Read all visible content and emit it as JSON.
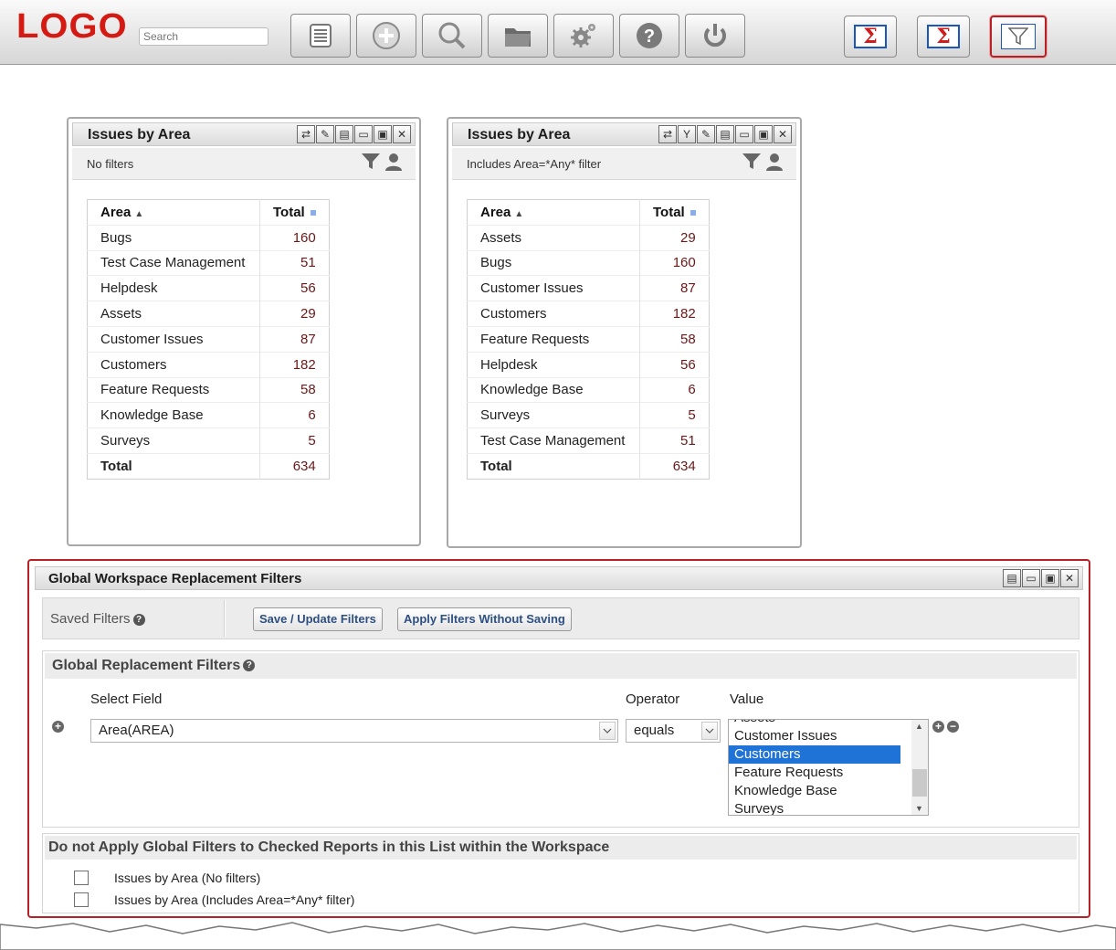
{
  "toolbar": {
    "logo": "LOGO",
    "search_placeholder": "Search",
    "buttons": [
      "list-icon",
      "add-icon",
      "search-icon",
      "folder-icon",
      "settings-icon",
      "help-icon",
      "power-icon"
    ],
    "sigma_glyph": "Σ"
  },
  "report1": {
    "title": "Issues by Area",
    "subtitle": "No filters",
    "header": {
      "area": "Area",
      "total": "Total"
    },
    "rows": [
      {
        "area": "Bugs",
        "total": "160"
      },
      {
        "area": "Test Case Management",
        "total": "51"
      },
      {
        "area": "Helpdesk",
        "total": "56"
      },
      {
        "area": "Assets",
        "total": "29"
      },
      {
        "area": "Customer Issues",
        "total": "87"
      },
      {
        "area": "Customers",
        "total": "182"
      },
      {
        "area": "Feature Requests",
        "total": "58"
      },
      {
        "area": "Knowledge Base",
        "total": "6"
      },
      {
        "area": "Surveys",
        "total": "5"
      }
    ],
    "total": {
      "label": "Total",
      "value": "634"
    }
  },
  "report2": {
    "title": "Issues by Area",
    "subtitle": "Includes Area=*Any* filter",
    "header": {
      "area": "Area",
      "total": "Total"
    },
    "rows": [
      {
        "area": "Assets",
        "total": "29"
      },
      {
        "area": "Bugs",
        "total": "160"
      },
      {
        "area": "Customer Issues",
        "total": "87"
      },
      {
        "area": "Customers",
        "total": "182"
      },
      {
        "area": "Feature Requests",
        "total": "58"
      },
      {
        "area": "Helpdesk",
        "total": "56"
      },
      {
        "area": "Knowledge Base",
        "total": "6"
      },
      {
        "area": "Surveys",
        "total": "5"
      },
      {
        "area": "Test Case Management",
        "total": "51"
      }
    ],
    "total": {
      "label": "Total",
      "value": "634"
    }
  },
  "global": {
    "title": "Global Workspace Replacement Filters",
    "saved_filters_label": "Saved Filters",
    "save_button": "Save / Update Filters",
    "apply_button": "Apply Filters Without Saving",
    "section_title": "Global Replacement Filters",
    "col_field": "Select Field",
    "col_operator": "Operator",
    "col_value": "Value",
    "field_value": "Area(AREA)",
    "operator_value": "equals",
    "value_options": [
      "Assets",
      "Customer Issues",
      "Customers",
      "Feature Requests",
      "Knowledge Base",
      "Surveys"
    ],
    "value_selected": "Customers",
    "exclude_title": "Do not Apply Global Filters to Checked Reports in this List within the Workspace",
    "exclude_items": [
      {
        "label": "Issues by Area (No filters)",
        "checked": false
      },
      {
        "label": "Issues by Area (Includes Area=*Any* filter)",
        "checked": false
      }
    ]
  },
  "colors": {
    "logo": "#d41a12",
    "highlight_border": "#b72025",
    "selected_option": "#1f72d6",
    "numbers": "#6a1818"
  }
}
